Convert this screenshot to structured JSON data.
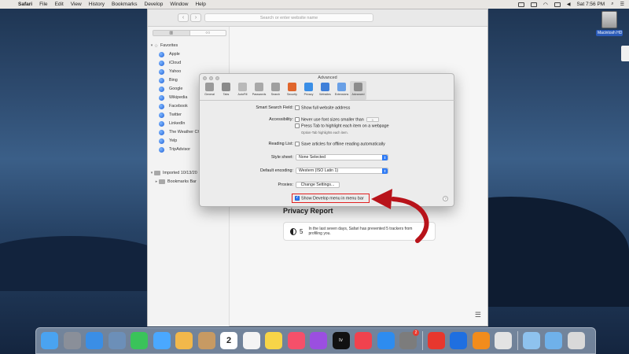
{
  "menubar": {
    "app": "Safari",
    "items": [
      "File",
      "Edit",
      "View",
      "History",
      "Bookmarks",
      "Develop",
      "Window",
      "Help"
    ],
    "clock": "Sat 7:56 PM"
  },
  "desktop": {
    "hd_label": "Macintosh HD"
  },
  "safari": {
    "url_placeholder": "Search or enter website name",
    "sidebar": {
      "favorites_label": "Favorites",
      "favorites": [
        "Apple",
        "iCloud",
        "Yahoo",
        "Bing",
        "Google",
        "Wikipedia",
        "Facebook",
        "Twitter",
        "LinkedIn",
        "The Weather Cha",
        "Yelp",
        "TripAdvisor"
      ],
      "imported_label": "Imported 10/13/20",
      "bookmarks_bar_label": "Bookmarks Bar"
    },
    "privacy": {
      "title": "Privacy Report",
      "count": "5",
      "text": "In the last seven days, Safari has prevented 5 trackers from profiling you."
    }
  },
  "prefs": {
    "title": "Advanced",
    "tabs": [
      "General",
      "Tabs",
      "AutoFill",
      "Passwords",
      "Search",
      "Security",
      "Privacy",
      "Websites",
      "Extensions",
      "Advanced"
    ],
    "active_tab": "Advanced",
    "rows": {
      "smart_search_label": "Smart Search Field:",
      "smart_search_option": "Show full website address",
      "accessibility_label": "Accessibility:",
      "accessibility_opt1": "Never use font sizes smaller than",
      "font_size_value": "9",
      "accessibility_opt2": "Press Tab to highlight each item on a webpage",
      "accessibility_hint": "Option-Tab highlights each item.",
      "reading_list_label": "Reading List:",
      "reading_list_option": "Save articles for offline reading automatically",
      "style_sheet_label": "Style sheet:",
      "style_sheet_value": "None Selected",
      "encoding_label": "Default encoding:",
      "encoding_value": "Western (ISO Latin 1)",
      "proxies_label": "Proxies:",
      "proxies_button": "Change Settings...",
      "develop_option": "Show Develop menu in menu bar"
    },
    "develop_checked": true,
    "help": "?"
  },
  "dock": {
    "apps": [
      {
        "name": "finder-icon",
        "color": "#4aa3f0"
      },
      {
        "name": "launchpad-icon",
        "color": "#8a8f99"
      },
      {
        "name": "safari-icon",
        "color": "#3a8ee6"
      },
      {
        "name": "preview-icon",
        "color": "#6c8fb8"
      },
      {
        "name": "facetime-icon",
        "color": "#3ac35a"
      },
      {
        "name": "messages-icon",
        "color": "#4aa8ff"
      },
      {
        "name": "photos-icon",
        "color": "#f2b84b"
      },
      {
        "name": "contacts-icon",
        "color": "#c79a63"
      },
      {
        "name": "calendar-icon",
        "color": "#ffffff",
        "text": "2"
      },
      {
        "name": "reminders-icon",
        "color": "#f4f4f4"
      },
      {
        "name": "notes-icon",
        "color": "#f7d548"
      },
      {
        "name": "music-icon",
        "color": "#f5506a"
      },
      {
        "name": "podcasts-icon",
        "color": "#9b4fe0"
      },
      {
        "name": "tv-icon",
        "color": "#111111",
        "text": "tv"
      },
      {
        "name": "news-icon",
        "color": "#f1424e"
      },
      {
        "name": "app-store-icon",
        "color": "#2d8cf0"
      },
      {
        "name": "system-preferences-icon",
        "color": "#7c7c7c",
        "badge": "2"
      }
    ],
    "extras": [
      {
        "name": "anydesk-icon",
        "color": "#e7372e"
      },
      {
        "name": "teamviewer-icon",
        "color": "#1f6fe0"
      },
      {
        "name": "vlc-icon",
        "color": "#f28c1c"
      },
      {
        "name": "chrome-icon",
        "color": "#e3e3e3"
      }
    ],
    "trailing": [
      {
        "name": "folder-icon",
        "color": "#8ec2ee"
      },
      {
        "name": "downloads-folder-icon",
        "color": "#6fb1ea"
      },
      {
        "name": "trash-icon",
        "color": "#d9d9d9"
      }
    ]
  }
}
